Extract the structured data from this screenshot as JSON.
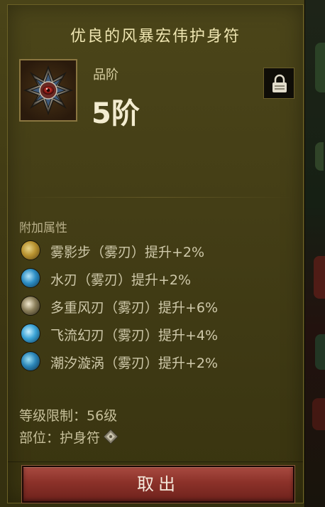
{
  "item": {
    "name": "优良的风暴宏伟护身符",
    "grade_label": "品阶",
    "grade_value": "5阶"
  },
  "attributes": {
    "heading": "附加属性",
    "items": [
      {
        "text": "雾影步（雾刃）提升+2%",
        "icon": "wind-step-skill-icon"
      },
      {
        "text": "水刃（雾刃）提升+2%",
        "icon": "water-blade-skill-icon"
      },
      {
        "text": "多重风刃（雾刃）提升+6%",
        "icon": "multi-wind-blade-skill-icon"
      },
      {
        "text": "飞流幻刃（雾刃）提升+4%",
        "icon": "flying-blade-skill-icon"
      },
      {
        "text": "潮汐漩涡（雾刃）提升+2%",
        "icon": "tidal-vortex-skill-icon"
      }
    ]
  },
  "requirements": {
    "level": "等级限制：56级",
    "slot_label": "部位：",
    "slot_value": "护身符",
    "slot_icon": "amulet-slot-icon"
  },
  "actions": {
    "take_out_label": "取出"
  },
  "colors": {
    "panel_bg": "#443e16",
    "title_text": "#efe6b2",
    "button_red": "#8b3129"
  }
}
